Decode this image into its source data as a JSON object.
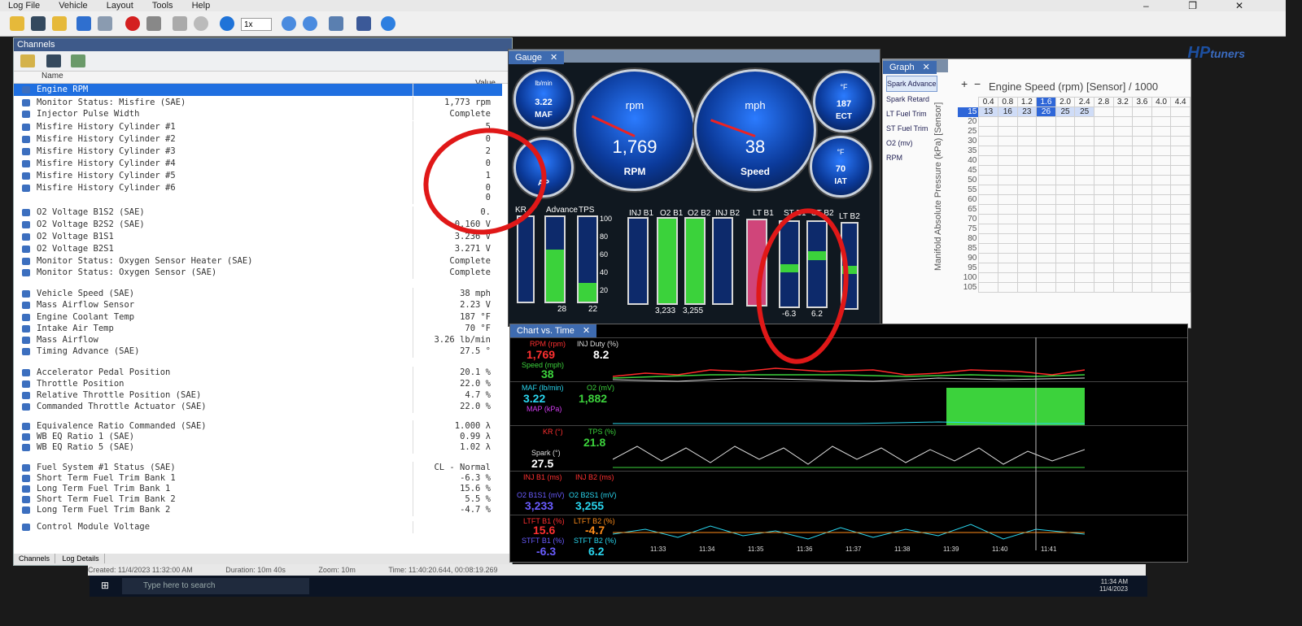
{
  "menu": [
    "Log File",
    "Vehicle",
    "Layout",
    "Tools",
    "Help"
  ],
  "toolbar": {
    "speed": "1x"
  },
  "brand": {
    "hp": "HP",
    "tuners": "tuners"
  },
  "channels": {
    "title": "Channels",
    "col_name": "Name",
    "col_value": "Value",
    "rows": [
      {
        "n": "Engine RPM",
        "v": ""
      },
      {
        "n": "Monitor Status: Misfire (SAE)",
        "v": "1,773 rpm"
      },
      {
        "n": "Injector Pulse Width",
        "v": "Complete"
      },
      {
        "n": "Misfire History Cylinder #1",
        "v": "5"
      },
      {
        "n": "Misfire History Cylinder #2",
        "v": "0"
      },
      {
        "n": "Misfire History Cylinder #3",
        "v": "2"
      },
      {
        "n": "Misfire History Cylinder #4",
        "v": "0"
      },
      {
        "n": "Misfire History Cylinder #5",
        "v": "1"
      },
      {
        "n": "Misfire History Cylinder #6",
        "v": "0"
      },
      {
        "n": "",
        "v": "0"
      },
      {
        "n": "O2 Voltage B1S2 (SAE)",
        "v": "0."
      },
      {
        "n": "O2 Voltage B2S2 (SAE)",
        "v": "0.160 V"
      },
      {
        "n": "O2 Voltage B1S1",
        "v": "3.236 V"
      },
      {
        "n": "O2 Voltage B2S1",
        "v": "3.271 V"
      },
      {
        "n": "Monitor Status: Oxygen Sensor Heater (SAE)",
        "v": "Complete"
      },
      {
        "n": "Monitor Status: Oxygen Sensor (SAE)",
        "v": "Complete"
      },
      {
        "n": "Vehicle Speed (SAE)",
        "v": "38 mph"
      },
      {
        "n": "Mass Airflow Sensor",
        "v": "2.23 V"
      },
      {
        "n": "Engine Coolant Temp",
        "v": "187 °F"
      },
      {
        "n": "Intake Air Temp",
        "v": "70 °F"
      },
      {
        "n": "Mass Airflow",
        "v": "3.26 lb/min"
      },
      {
        "n": "Timing Advance (SAE)",
        "v": "27.5 °"
      },
      {
        "n": "Accelerator Pedal Position",
        "v": "20.1 %"
      },
      {
        "n": "Throttle Position",
        "v": "22.0 %"
      },
      {
        "n": "Relative Throttle Position (SAE)",
        "v": "4.7 %"
      },
      {
        "n": "Commanded Throttle Actuator (SAE)",
        "v": "22.0 %"
      },
      {
        "n": "Equivalence Ratio Commanded (SAE)",
        "v": "1.000 λ"
      },
      {
        "n": "WB EQ Ratio 1 (SAE)",
        "v": "0.99 λ"
      },
      {
        "n": "WB EQ Ratio 5 (SAE)",
        "v": "1.02 λ"
      },
      {
        "n": "Fuel System #1 Status (SAE)",
        "v": "CL - Normal"
      },
      {
        "n": "Short Term Fuel Trim Bank 1",
        "v": "-6.3 %"
      },
      {
        "n": "Long Term Fuel Trim Bank 1",
        "v": "15.6 %"
      },
      {
        "n": "Short Term Fuel Trim Bank 2",
        "v": "5.5 %"
      },
      {
        "n": "Long Term Fuel Trim Bank 2",
        "v": "-4.7 %"
      },
      {
        "n": "Control Module Voltage",
        "v": ""
      }
    ],
    "tabs": [
      "Channels",
      "Log Details"
    ]
  },
  "status": {
    "created": "Created: 11/4/2023 11:32:00 AM",
    "duration": "Duration: 10m 40s",
    "zoom": "Zoom: 10m",
    "time": "Time: 11:40:20.644, 00:08:19.269"
  },
  "gauge_tab": "Gauge",
  "gauges": {
    "maf": {
      "unit": "lb/min",
      "value": "3.22",
      "label": "MAF"
    },
    "rpm": {
      "unit": "rpm",
      "value": "1,769",
      "label": "RPM"
    },
    "speed": {
      "unit": "mph",
      "value": "38",
      "label": "Speed"
    },
    "ect": {
      "unit": "°F",
      "value": "187",
      "label": "ECT"
    },
    "map": {
      "label": "AP"
    },
    "iat": {
      "unit": "°F",
      "value": "70",
      "label": "IAT"
    }
  },
  "bars": {
    "labels": [
      "KR",
      "Advance",
      "TPS",
      "INJ B1",
      "O2 B1",
      "O2 B2",
      "INJ B2",
      "LT B1",
      "ST B1",
      "ST B2",
      "LT B2"
    ],
    "values": {
      "adv": "28",
      "tps": "22",
      "o2b1": "3,233",
      "o2b2": "3,255",
      "stb1": "-6.3",
      "stb2": "6.2"
    }
  },
  "graph": {
    "tab": "Graph",
    "items": [
      "Spark Advance",
      "Spark Retard",
      "LT Fuel Trim",
      "ST Fuel Trim",
      "O2 (mv)",
      "RPM"
    ],
    "title": "Engine Speed (rpm) [Sensor] / 1000",
    "yaxis": "Manifold Absolute Pressure (kPa) [Sensor]",
    "cols": [
      "0.4",
      "0.8",
      "1.2",
      "1.6",
      "2.0",
      "2.4",
      "2.8",
      "3.2",
      "3.6",
      "4.0",
      "4.4"
    ],
    "rows": [
      "15",
      "20",
      "25",
      "30",
      "35",
      "40",
      "45",
      "50",
      "55",
      "60",
      "65",
      "70",
      "75",
      "80",
      "85",
      "90",
      "95",
      "100",
      "105"
    ],
    "row0": [
      "13",
      "16",
      "23",
      "26",
      "25",
      "25"
    ]
  },
  "cvt": {
    "tab": "Chart vs. Time",
    "rpm_lbl": "RPM (rpm)",
    "rpm": "1,769",
    "inj_lbl": "INJ Duty (%)",
    "inj": "8.2",
    "spd_lbl": "Speed (mph)",
    "spd": "38",
    "maf_lbl": "MAF (lb/min)",
    "maf": "3.22",
    "o2_lbl": "O2 (mV)",
    "o2": "1,882",
    "map_lbl": "MAP (kPa)",
    "kr_lbl": "KR (°)",
    "tps_lbl": "TPS (%)",
    "tps": "21.8",
    "spark_lbl": "Spark (°)",
    "spark": "27.5",
    "injb1_lbl": "INJ B1 (ms)",
    "injb2_lbl": "INJ B2 (ms)",
    "o2b1_lbl": "O2 B1S1 (mV)",
    "o2b1": "3,233",
    "o2b2_lbl": "O2 B2S1 (mV)",
    "o2b2": "3,255",
    "ltft1_lbl": "LTFT B1 (%)",
    "ltft1": "15.6",
    "ltft2_lbl": "LTFT B2 (%)",
    "ltft2": "-4.7",
    "stft1_lbl": "STFT B1 (%)",
    "stft1": "-6.3",
    "stft2_lbl": "STFT B2 (%)",
    "stft2": "6.2",
    "times": [
      "11:33",
      "11:34",
      "11:35",
      "11:36",
      "11:37",
      "11:38",
      "11:39",
      "11:40",
      "11:41"
    ]
  },
  "taskbar": {
    "search": "Type here to search",
    "time": "11:34 AM",
    "date": "11/4/2023"
  }
}
